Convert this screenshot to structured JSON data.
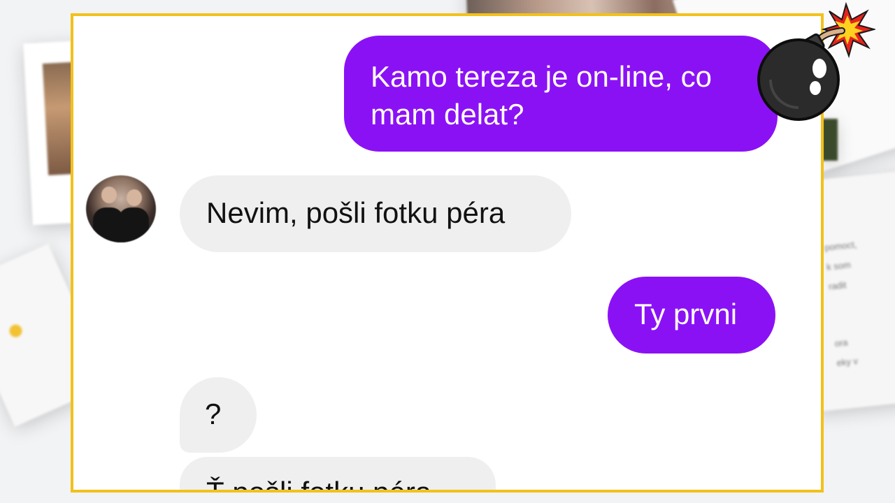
{
  "background": {
    "right_sheet_lines": [
      "pomoct,",
      "k som",
      "radit",
      "ora",
      "eky v"
    ]
  },
  "chat": {
    "messages": [
      {
        "side": "sent",
        "text_line1": "Kamo tereza je on-line, co",
        "text_line2": "mam delat?"
      },
      {
        "side": "received",
        "text": "Nevim, pošli fotku péra"
      },
      {
        "side": "sent",
        "text": "Ty prvni"
      },
      {
        "side": "received",
        "text": "?"
      },
      {
        "side": "received",
        "text": "Ť pošli fotku péra"
      }
    ]
  },
  "colors": {
    "frame_border": "#f2c11b",
    "sent_bubble": "#8b11f5",
    "received_bubble": "#efefef"
  },
  "icons": {
    "sticker": "bomb-icon",
    "avatar": "avatar"
  }
}
